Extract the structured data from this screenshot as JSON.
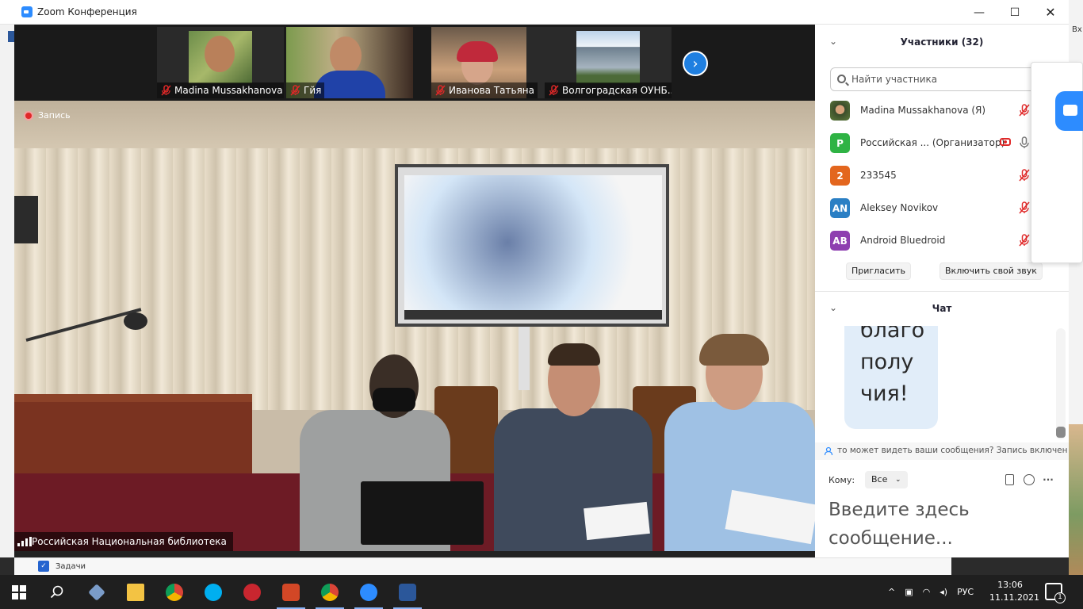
{
  "window": {
    "title": "Zoom Конференция"
  },
  "background_app": {
    "right_text": "Вх",
    "tasks_label": "Задачи"
  },
  "video": {
    "recording_label": "Запись",
    "main_speaker_name": "Российская Национальная библиотека",
    "thumbnails": [
      {
        "name": "Madina Mussakhanova",
        "muted": true
      },
      {
        "name": "Гйя",
        "muted": true
      },
      {
        "name": "Иванова Татьяна",
        "muted": true
      },
      {
        "name": "Волгоградская ОУНБ...",
        "muted": true
      }
    ]
  },
  "participants": {
    "title": "Участники (32)",
    "search_placeholder": "Найти участника",
    "list": [
      {
        "name": "Madina Mussakhanova (Я)",
        "avatar": "",
        "avatar_color": "",
        "muted": true
      },
      {
        "name": "Российская ... (Организатор)",
        "avatar": "Р",
        "avatar_color": "#2fb344",
        "muted": false,
        "recording": true
      },
      {
        "name": "233545",
        "avatar": "2",
        "avatar_color": "#e3661e",
        "muted": true
      },
      {
        "name": "Aleksey Novikov",
        "avatar": "AN",
        "avatar_color": "#2a7fc4",
        "muted": true
      },
      {
        "name": "Android Bluedroid",
        "avatar": "AB",
        "avatar_color": "#8e3fb0",
        "muted": true
      }
    ],
    "invite_label": "Пригласить",
    "unmute_label": "Включить свой звук"
  },
  "chat": {
    "title": "Чат",
    "bubble_lines": [
      "благо",
      "полу",
      "чия!"
    ],
    "notice": "то может видеть ваши сообщения? Запись включен",
    "to_label": "Кому:",
    "to_value": "Все",
    "input_placeholder": "Введите здесь сообщение..."
  },
  "taskbar": {
    "language": "РУС",
    "time": "13:06",
    "date": "11.11.2021",
    "notifications": "1"
  },
  "icons": {
    "muted_mic": "mic-muted-icon",
    "mic": "mic-icon",
    "search": "search-icon",
    "chevron": "chevron-down-icon"
  },
  "colors": {
    "accent": "#2d8cff",
    "muted": "#e02828",
    "bubble": "#e1edf9"
  }
}
